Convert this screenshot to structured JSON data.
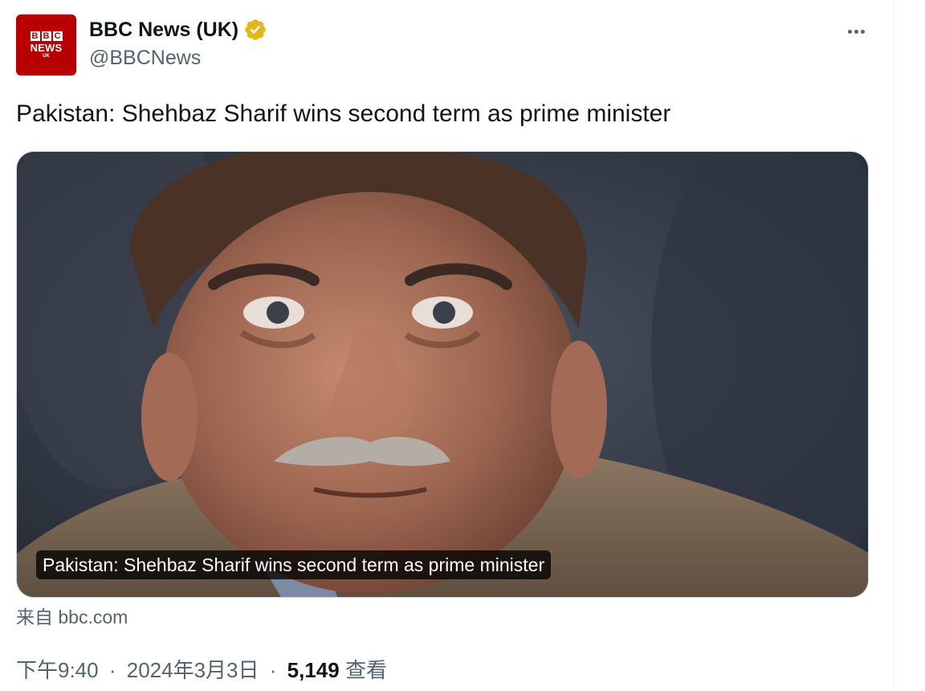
{
  "author": {
    "display_name": "BBC News (UK)",
    "handle": "@BBCNews",
    "verified": true,
    "verified_badge_color": "#e2b719",
    "avatar": {
      "letters": [
        "B",
        "B",
        "C"
      ],
      "news_text": "NEWS",
      "region_text": "UK",
      "background_color": "#b80000"
    }
  },
  "more_menu_icon": "more-horizontal-icon",
  "tweet": {
    "text": "Pakistan: Shehbaz Sharif wins second term as prime minister"
  },
  "media": {
    "caption": "Pakistan: Shehbaz Sharif wins second term as prime minister"
  },
  "source": {
    "label": "来自 bbc.com"
  },
  "meta": {
    "time": "下午9:40",
    "separator": "·",
    "date": "2024年3月3日",
    "views_count": "5,149",
    "views_label": "查看"
  },
  "colors": {
    "text_primary": "#0f1419",
    "text_secondary": "#536471",
    "border": "#cfd9de"
  }
}
